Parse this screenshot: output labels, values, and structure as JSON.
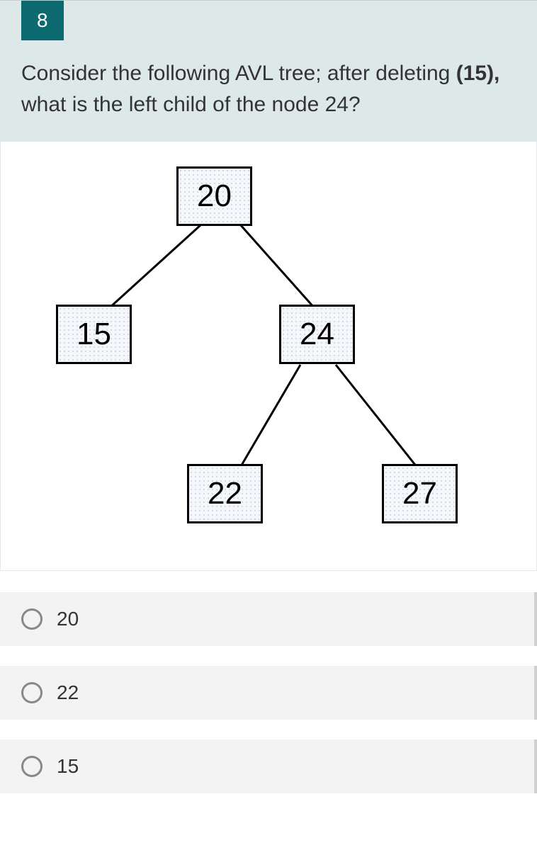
{
  "question": {
    "number": "8",
    "text_part1": "Consider the following AVL tree;  after deleting ",
    "bold1": "(15),",
    "text_part2": " what is the left child of the node 24?"
  },
  "tree": {
    "root": "20",
    "left": "15",
    "right": "24",
    "right_left": "22",
    "right_right": "27"
  },
  "options": [
    {
      "label": "20"
    },
    {
      "label": "22"
    },
    {
      "label": "15"
    }
  ]
}
